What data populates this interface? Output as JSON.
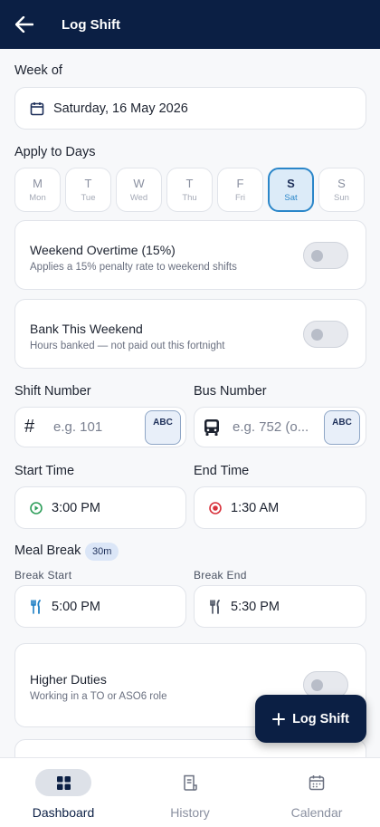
{
  "header": {
    "title": "Log Shift"
  },
  "week": {
    "label": "Week of",
    "value": "Saturday, 16 May 2026"
  },
  "days": {
    "label": "Apply to Days",
    "items": [
      {
        "letter": "M",
        "short": "Mon",
        "active": false
      },
      {
        "letter": "T",
        "short": "Tue",
        "active": false
      },
      {
        "letter": "W",
        "short": "Wed",
        "active": false
      },
      {
        "letter": "T",
        "short": "Thu",
        "active": false
      },
      {
        "letter": "F",
        "short": "Fri",
        "active": false
      },
      {
        "letter": "S",
        "short": "Sat",
        "active": true
      },
      {
        "letter": "S",
        "short": "Sun",
        "active": false
      }
    ]
  },
  "weekend_overtime": {
    "title": "Weekend Overtime (15%)",
    "subtitle": "Applies a 15% penalty rate to weekend shifts",
    "on": false
  },
  "bank_weekend": {
    "title": "Bank This Weekend",
    "subtitle": "Hours banked — not paid out this fortnight",
    "on": false
  },
  "shift_number": {
    "label": "Shift Number",
    "placeholder": "e.g. 101",
    "keyboard": "ABC"
  },
  "bus_number": {
    "label": "Bus Number",
    "placeholder": "e.g. 752 (o...",
    "keyboard": "ABC"
  },
  "start_time": {
    "label": "Start Time",
    "value": "3:00 PM"
  },
  "end_time": {
    "label": "End Time",
    "value": "1:30 AM"
  },
  "meal_break": {
    "label": "Meal Break",
    "badge": "30m",
    "start_label": "Break Start",
    "start_value": "5:00 PM",
    "end_label": "Break End",
    "end_value": "5:30 PM"
  },
  "higher_duties": {
    "title": "Higher Duties",
    "subtitle": "Working in a TO or ASO6 role",
    "on": false
  },
  "fab": {
    "label": "Log Shift"
  },
  "nav": {
    "dashboard": "Dashboard",
    "history": "History",
    "calendar": "Calendar"
  },
  "colors": {
    "navy": "#0b1f44",
    "accent": "#2a86c9",
    "start_icon": "#2e9e5a",
    "end_icon": "#d8323c"
  }
}
